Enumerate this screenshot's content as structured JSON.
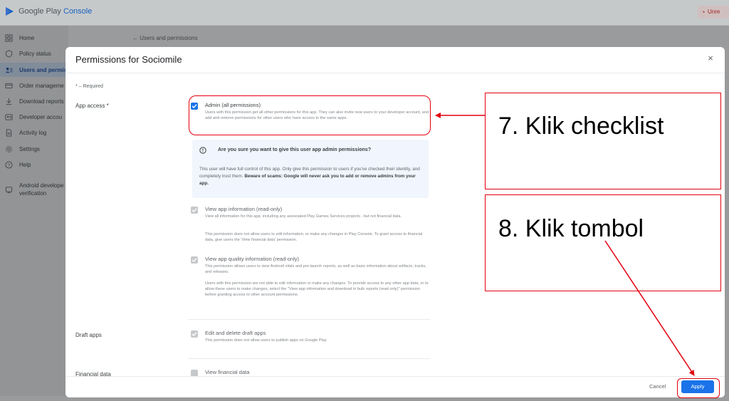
{
  "header": {
    "brand_prefix": "Google Play",
    "brand_accent": "Console",
    "chip_label": "Unre"
  },
  "sidebar": {
    "items": [
      {
        "label": "Home",
        "icon": "grid-icon"
      },
      {
        "label": "Policy status",
        "icon": "shield-icon"
      },
      {
        "label": "Users and permis",
        "icon": "users-icon",
        "active": true
      },
      {
        "label": "Order manageme",
        "icon": "card-icon"
      },
      {
        "label": "Download reports",
        "icon": "download-icon"
      },
      {
        "label": "Developer accou",
        "icon": "developer-icon"
      },
      {
        "label": "Activity log",
        "icon": "document-icon"
      },
      {
        "label": "Settings",
        "icon": "gear-icon"
      },
      {
        "label": "Help",
        "icon": "help-icon"
      },
      {
        "label": "Android develope verification",
        "icon": "device-icon"
      }
    ]
  },
  "breadcrumb": "← Users and permissions",
  "dialog": {
    "title": "Permissions for Sociomile",
    "close_label": "×",
    "required_note": "* – Required",
    "app_access_label": "App access  *",
    "admin": {
      "title": "Admin (all permissions)",
      "desc": "Users with this permission get all other permissions for this app. They can also invite new users to your developer account, and add and remove permissions for other users who have access to the same apps.",
      "checked": true
    },
    "warning": {
      "title": "Are you sure you want to give this user app admin permissions?",
      "body": "This user will have full control of this app. Only give this permission to users if you've checked their identity, and completely trust them.",
      "bold": "Beware of scams: Google will never ask you to add or remove admins from your app."
    },
    "view_info": {
      "title": "View app information (read-only)",
      "desc1": "View all information for this app, including any associated Play Games Services projects - but not financial data.",
      "desc2": "This permission does not allow users to edit information, or make any changes in Play Console. To grant access to financial data, give users the 'View financial data' permission."
    },
    "view_quality": {
      "title": "View app quality information (read-only)",
      "desc1": "This permission allows users to view Android vitals and pre-launch reports, as well as basic information about artifacts, tracks, and releases.",
      "desc2": "Users with this permission are not able to edit information or make any changes. To provide access to any other app data, or to allow these users to make changes, select the \"View app information and download in bulk reports (read only)\" permission before granting access to other account permissions."
    },
    "draft_apps_label": "Draft apps",
    "edit_draft": {
      "title": "Edit and delete draft apps",
      "desc": "This permission does not allow users to publish apps on Google Play"
    },
    "financial_label": "Financial data",
    "view_financial": {
      "title": "View financial data"
    },
    "cancel_label": "Cancel",
    "apply_label": "Apply"
  },
  "annotations": {
    "step7": "7. Klik checklist",
    "step8": "8. Klik tombol",
    "color": "#e3000f"
  }
}
